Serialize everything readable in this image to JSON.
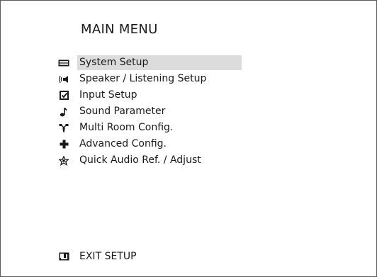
{
  "menu": {
    "title": "MAIN MENU",
    "items": [
      {
        "label": "System Setup",
        "icon": "system-icon",
        "selected": true
      },
      {
        "label": "Speaker / Listening Setup",
        "icon": "speaker-icon",
        "selected": false
      },
      {
        "label": "Input Setup",
        "icon": "input-checkbox-icon",
        "selected": false
      },
      {
        "label": "Sound Parameter",
        "icon": "music-note-icon",
        "selected": false
      },
      {
        "label": "Multi Room Config.",
        "icon": "multi-room-icon",
        "selected": false
      },
      {
        "label": "Advanced Config.",
        "icon": "plus-icon",
        "selected": false
      },
      {
        "label": "Quick Audio Ref. / Adjust",
        "icon": "star-icon",
        "selected": false
      }
    ],
    "exit": {
      "label": "EXIT SETUP",
      "icon": "exit-icon"
    }
  },
  "colors": {
    "highlight": "#dcdcdc",
    "text": "#1a1a1a",
    "border": "#5a5a5a"
  }
}
